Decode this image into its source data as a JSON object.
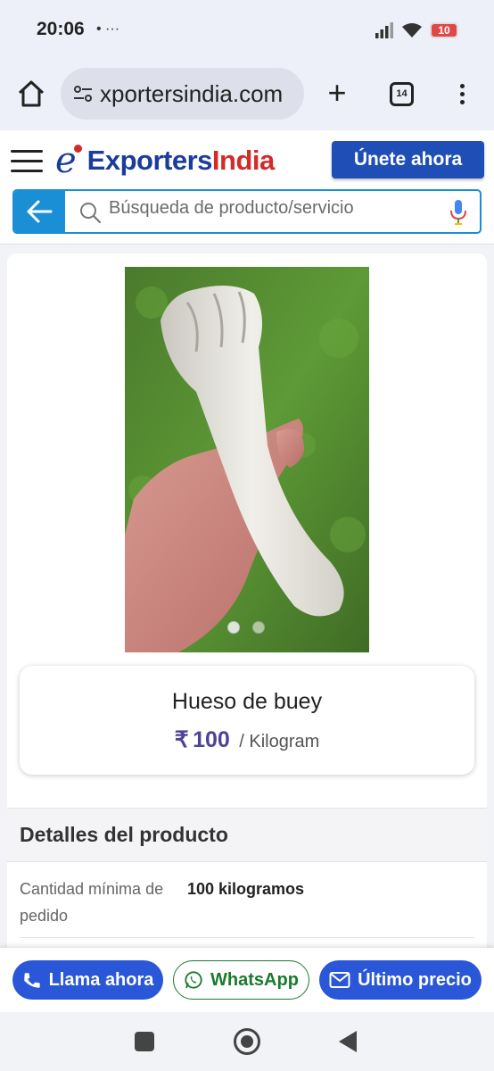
{
  "status_bar": {
    "time": "20:06",
    "notification_icons": "• ···",
    "battery_level": "10"
  },
  "browser": {
    "url": "xportersindia.com",
    "tab_count": "14",
    "new_tab_symbol": "+"
  },
  "header": {
    "logo_letter": "e",
    "logo_part1": "Exporters",
    "logo_part2": "India",
    "join_button": "Únete ahora",
    "search_placeholder": "Búsqueda de producto/servicio"
  },
  "product": {
    "name": "Hueso de buey",
    "currency": "₹",
    "price": "100",
    "unit": "/ Kilogram",
    "image_dots": 2,
    "active_dot": 1
  },
  "details": {
    "title": "Detalles del producto",
    "rows": [
      {
        "label": "Cantidad mínima de pedido",
        "value": "100 kilogramos"
      }
    ]
  },
  "actions": {
    "call": "Llama ahora",
    "whatsapp": "WhatsApp",
    "price": "Último precio"
  },
  "colors": {
    "brand_blue": "#1b3c9c",
    "brand_red": "#d42a2a",
    "join_button": "#1f4fb6",
    "search_accent": "#1a8fd6",
    "price": "#4d4396",
    "action_blue": "#2a56d8",
    "whatsapp_green": "#1a7a2e"
  },
  "icons": [
    "home-icon",
    "site-settings-icon",
    "plus-icon",
    "tab-switcher-icon",
    "more-vert-icon",
    "hamburger-icon",
    "arrow-left-icon",
    "search-icon",
    "microphone-icon",
    "phone-icon",
    "whatsapp-icon",
    "mail-icon",
    "recents-icon",
    "nav-home-icon",
    "nav-back-icon"
  ]
}
